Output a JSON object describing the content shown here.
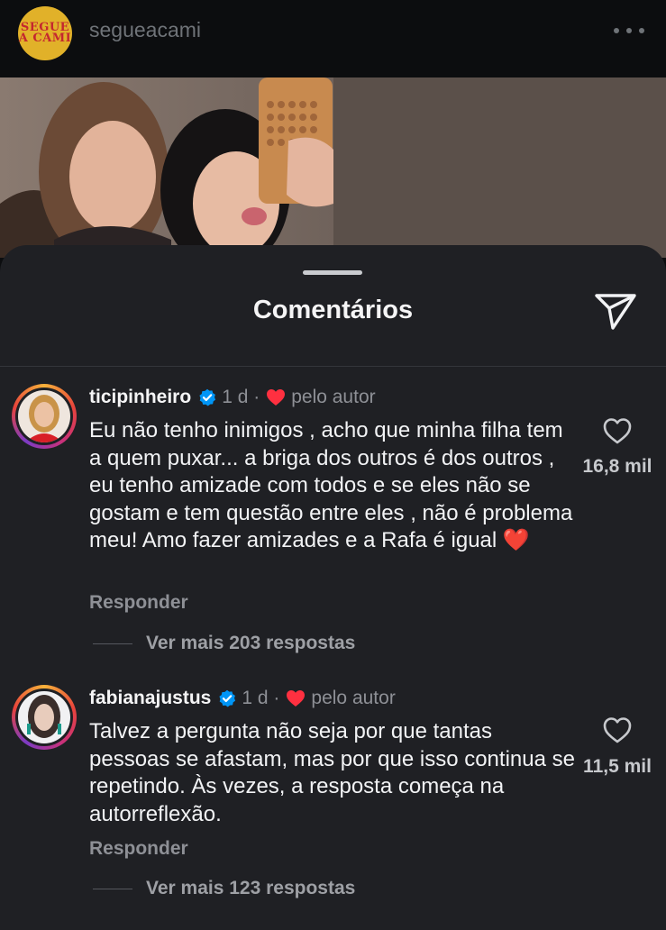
{
  "header": {
    "account_name": "segueacami",
    "avatar_text_line1": "SEGUE",
    "avatar_text_line2": "A CAMI"
  },
  "sheet": {
    "title": "Comentários"
  },
  "comments": [
    {
      "username": "ticipinheiro",
      "time": "1 d ·",
      "by_author": "pelo autor",
      "text": "Eu não tenho inimigos , acho que minha filha tem a quem puxar... a briga dos outros é dos outros , eu tenho amizade com todos e se eles não se gostam e tem questão entre eles , não é problema meu! Amo fazer amizades e a Rafa é igual ❤️",
      "likes": "16,8 mil",
      "reply_label": "Responder",
      "more_replies": "Ver mais 203 respostas"
    },
    {
      "username": "fabianajustus",
      "time": "1 d ·",
      "by_author": "pelo autor",
      "text": "Talvez a pergunta não seja por que tantas pessoas se afastam, mas por que isso continua se repetindo. Às vezes, a resposta começa na autorreflexão.",
      "likes": "11,5 mil",
      "reply_label": "Responder",
      "more_replies": "Ver mais 123 respostas"
    }
  ],
  "colors": {
    "background": "#0c0d0f",
    "sheet": "#1f2024",
    "heart_red": "#ff3040",
    "verified_blue": "#0095f6",
    "muted_text": "#8e9096"
  },
  "icons": [
    "more-icon",
    "share-icon",
    "verified-icon",
    "heart-icon",
    "like-outline-icon"
  ]
}
